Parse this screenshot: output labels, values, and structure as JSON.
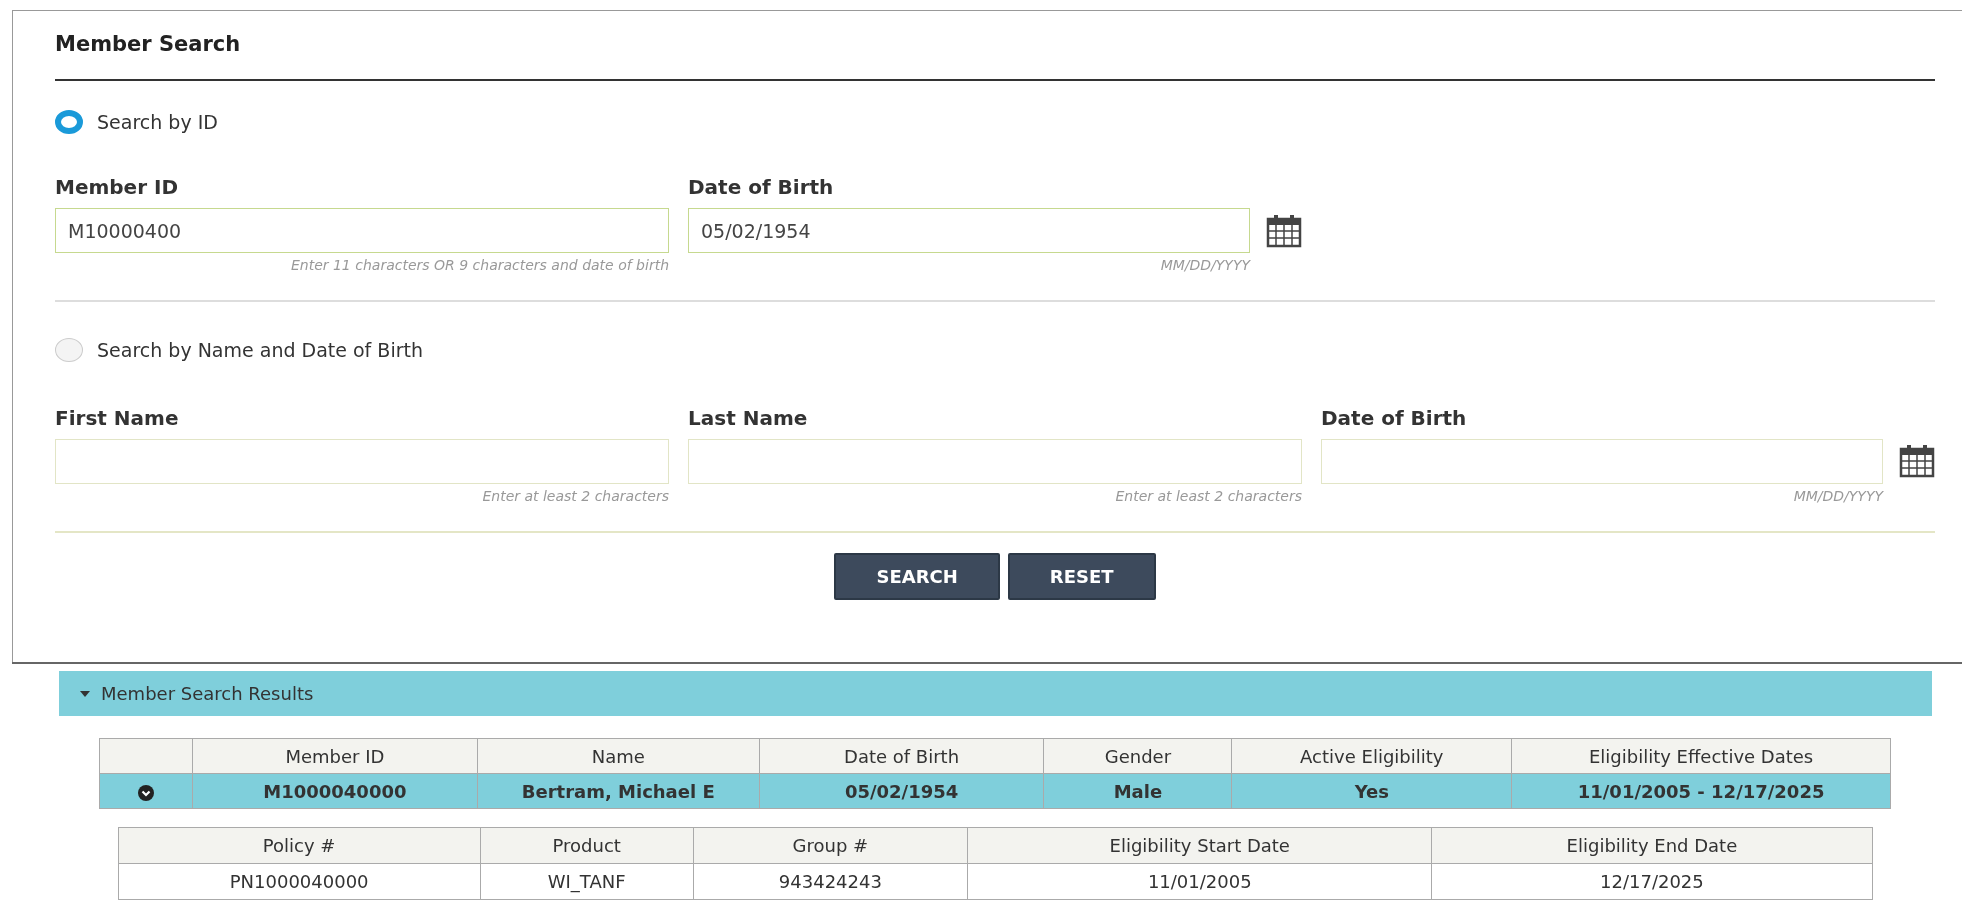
{
  "title": "Member Search",
  "search_modes": [
    {
      "label": "Search by ID",
      "selected": true,
      "fields": [
        {
          "kind": "text",
          "label": "Member ID",
          "value": "M10000400",
          "hint": "Enter 11 characters OR 9 characters and date of birth"
        },
        {
          "kind": "date",
          "label": "Date of Birth",
          "value": "05/02/1954",
          "hint": "MM/DD/YYYY"
        }
      ]
    },
    {
      "label": "Search by Name and Date of Birth",
      "selected": false,
      "fields": [
        {
          "kind": "text",
          "label": "First Name",
          "hint": "Enter at least 2 characters"
        },
        {
          "kind": "text",
          "label": "Last Name",
          "hint": "Enter at least 2 characters"
        },
        {
          "kind": "date",
          "label": "Date of Birth",
          "hint": "MM/DD/YYYY"
        }
      ]
    }
  ],
  "buttons": [
    "SEARCH",
    "RESET"
  ],
  "results": {
    "title": "Member Search Results",
    "expanded": true,
    "columns": [
      "Member ID",
      "Name",
      "Date of Birth",
      "Gender",
      "Active Eligibility",
      "Eligibility Effective Dates"
    ],
    "rows": [
      {
        "expanded": true,
        "selected": true,
        "cells": [
          "M1000040000",
          "Bertram, Michael E",
          "05/02/1954",
          "Male",
          "Yes",
          "11/01/2005 - 12/17/2025"
        ],
        "detail": {
          "columns": [
            "Policy #",
            "Product",
            "Group #",
            "Eligibility Start Date",
            "Eligibility End Date"
          ],
          "rows": [
            [
              "PN1000040000",
              "WI_TANF",
              "943424243",
              "11/01/2005",
              "12/17/2025"
            ]
          ]
        }
      }
    ]
  }
}
